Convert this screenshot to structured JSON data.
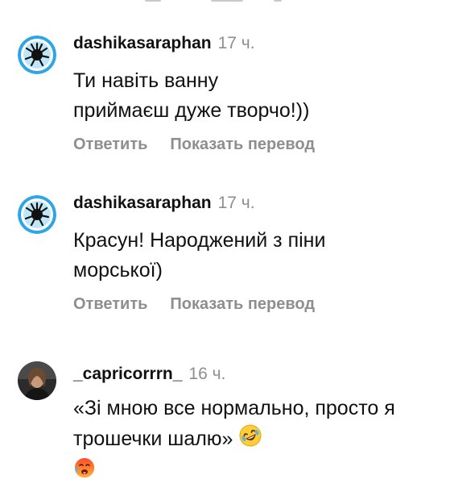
{
  "comments": [
    {
      "username": "dashikasaraphan",
      "time": "17 ч.",
      "text": "Ти навіть ванну приймаєш дуже творчо!))",
      "reply": "Ответить",
      "translate": "Показать перевод",
      "avatar_icon": "spiky-blue-ball-avatar"
    },
    {
      "username": "dashikasaraphan",
      "time": "17 ч.",
      "text": "Красун! Народжений з піни морської)",
      "reply": "Ответить",
      "translate": "Показать перевод",
      "avatar_icon": "spiky-blue-ball-avatar"
    },
    {
      "username": "_capricorrrn_",
      "time": "16 ч.",
      "text": "«Зі мною все нормально, просто я трошечки шалю»",
      "emojis": [
        "rolling-on-floor-laughing-emoji",
        "hot-face-emoji"
      ],
      "avatar_icon": "user-photo-avatar"
    }
  ],
  "colors": {
    "text": "#111111",
    "muted": "#8e8e8e",
    "avatar_blue": "#2ea6e6"
  }
}
